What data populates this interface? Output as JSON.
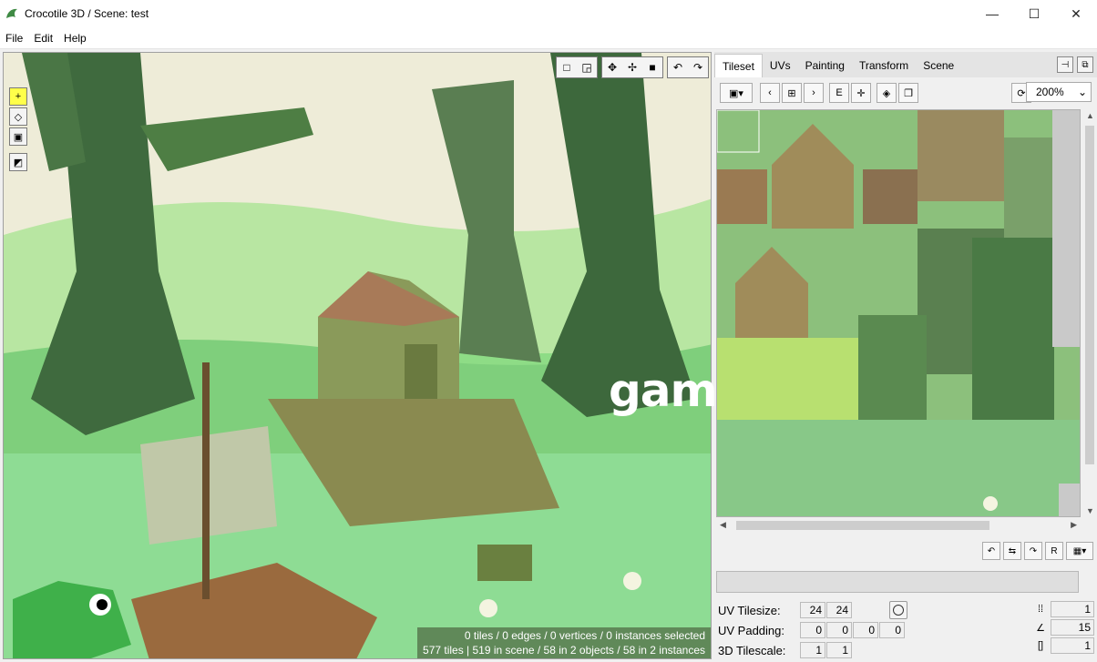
{
  "window": {
    "title": "Crocotile 3D / Scene: test",
    "minimize": "—",
    "maximize": "☐",
    "close": "✕"
  },
  "menu": [
    "File",
    "Edit",
    "Help"
  ],
  "viewport": {
    "status_line1": "0 tiles / 0 edges / 0 vertices / 0 instances selected",
    "status_line2": "577 tiles | 519 in scene / 58 in 2 objects / 58 in 2 instances"
  },
  "watermark": "gamck.com",
  "tabs": [
    "Tileset",
    "UVs",
    "Painting",
    "Transform",
    "Scene"
  ],
  "active_tab": "Tileset",
  "tileset_toolbar": {
    "zoom": "200%",
    "buttons": [
      "image-dropdown",
      "prev",
      "grid",
      "next",
      "E",
      "center",
      "layers",
      "copy",
      "refresh"
    ]
  },
  "properties": {
    "uv_tilesize_label": "UV Tilesize:",
    "uv_tilesize": [
      "24",
      "24"
    ],
    "uv_padding_label": "UV Padding:",
    "uv_padding": [
      "0",
      "0",
      "0",
      "0"
    ],
    "tilescale_label": "3D Tilescale:",
    "tilescale": [
      "1",
      "1"
    ],
    "right_values": [
      "1",
      "15",
      "1"
    ]
  },
  "colors": {
    "sky": "#eeecd8",
    "grass": "#8edc86",
    "tree": "#3f6a3e",
    "accent_tool": "#ffff4a"
  }
}
